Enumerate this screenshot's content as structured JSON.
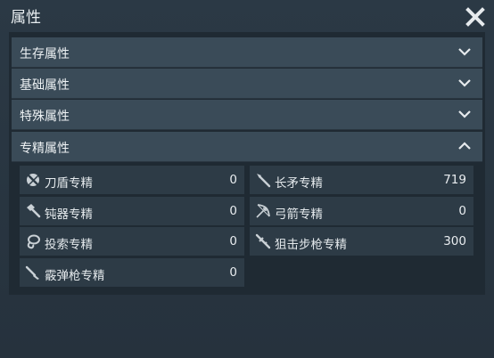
{
  "window": {
    "title": "属性"
  },
  "icons": {
    "close": "close-icon",
    "chevron_down": "chevron-down-icon",
    "chevron_up": "chevron-up-icon"
  },
  "sections": [
    {
      "label": "生存属性",
      "expanded": false
    },
    {
      "label": "基础属性",
      "expanded": false
    },
    {
      "label": "特殊属性",
      "expanded": false
    },
    {
      "label": "专精属性",
      "expanded": true
    }
  ],
  "mastery": {
    "items": [
      {
        "label": "刀盾专精",
        "value": "0",
        "icon": "sword-shield-icon"
      },
      {
        "label": "长矛专精",
        "value": "719",
        "icon": "spear-icon"
      },
      {
        "label": "钝器专精",
        "value": "0",
        "icon": "hammer-icon"
      },
      {
        "label": "弓箭专精",
        "value": "0",
        "icon": "bow-icon"
      },
      {
        "label": "投索专精",
        "value": "0",
        "icon": "lasso-icon"
      },
      {
        "label": "狙击步枪专精",
        "value": "300",
        "icon": "sniper-rifle-icon"
      },
      {
        "label": "霰弹枪专精",
        "value": "0",
        "icon": "shotgun-icon"
      }
    ]
  }
}
